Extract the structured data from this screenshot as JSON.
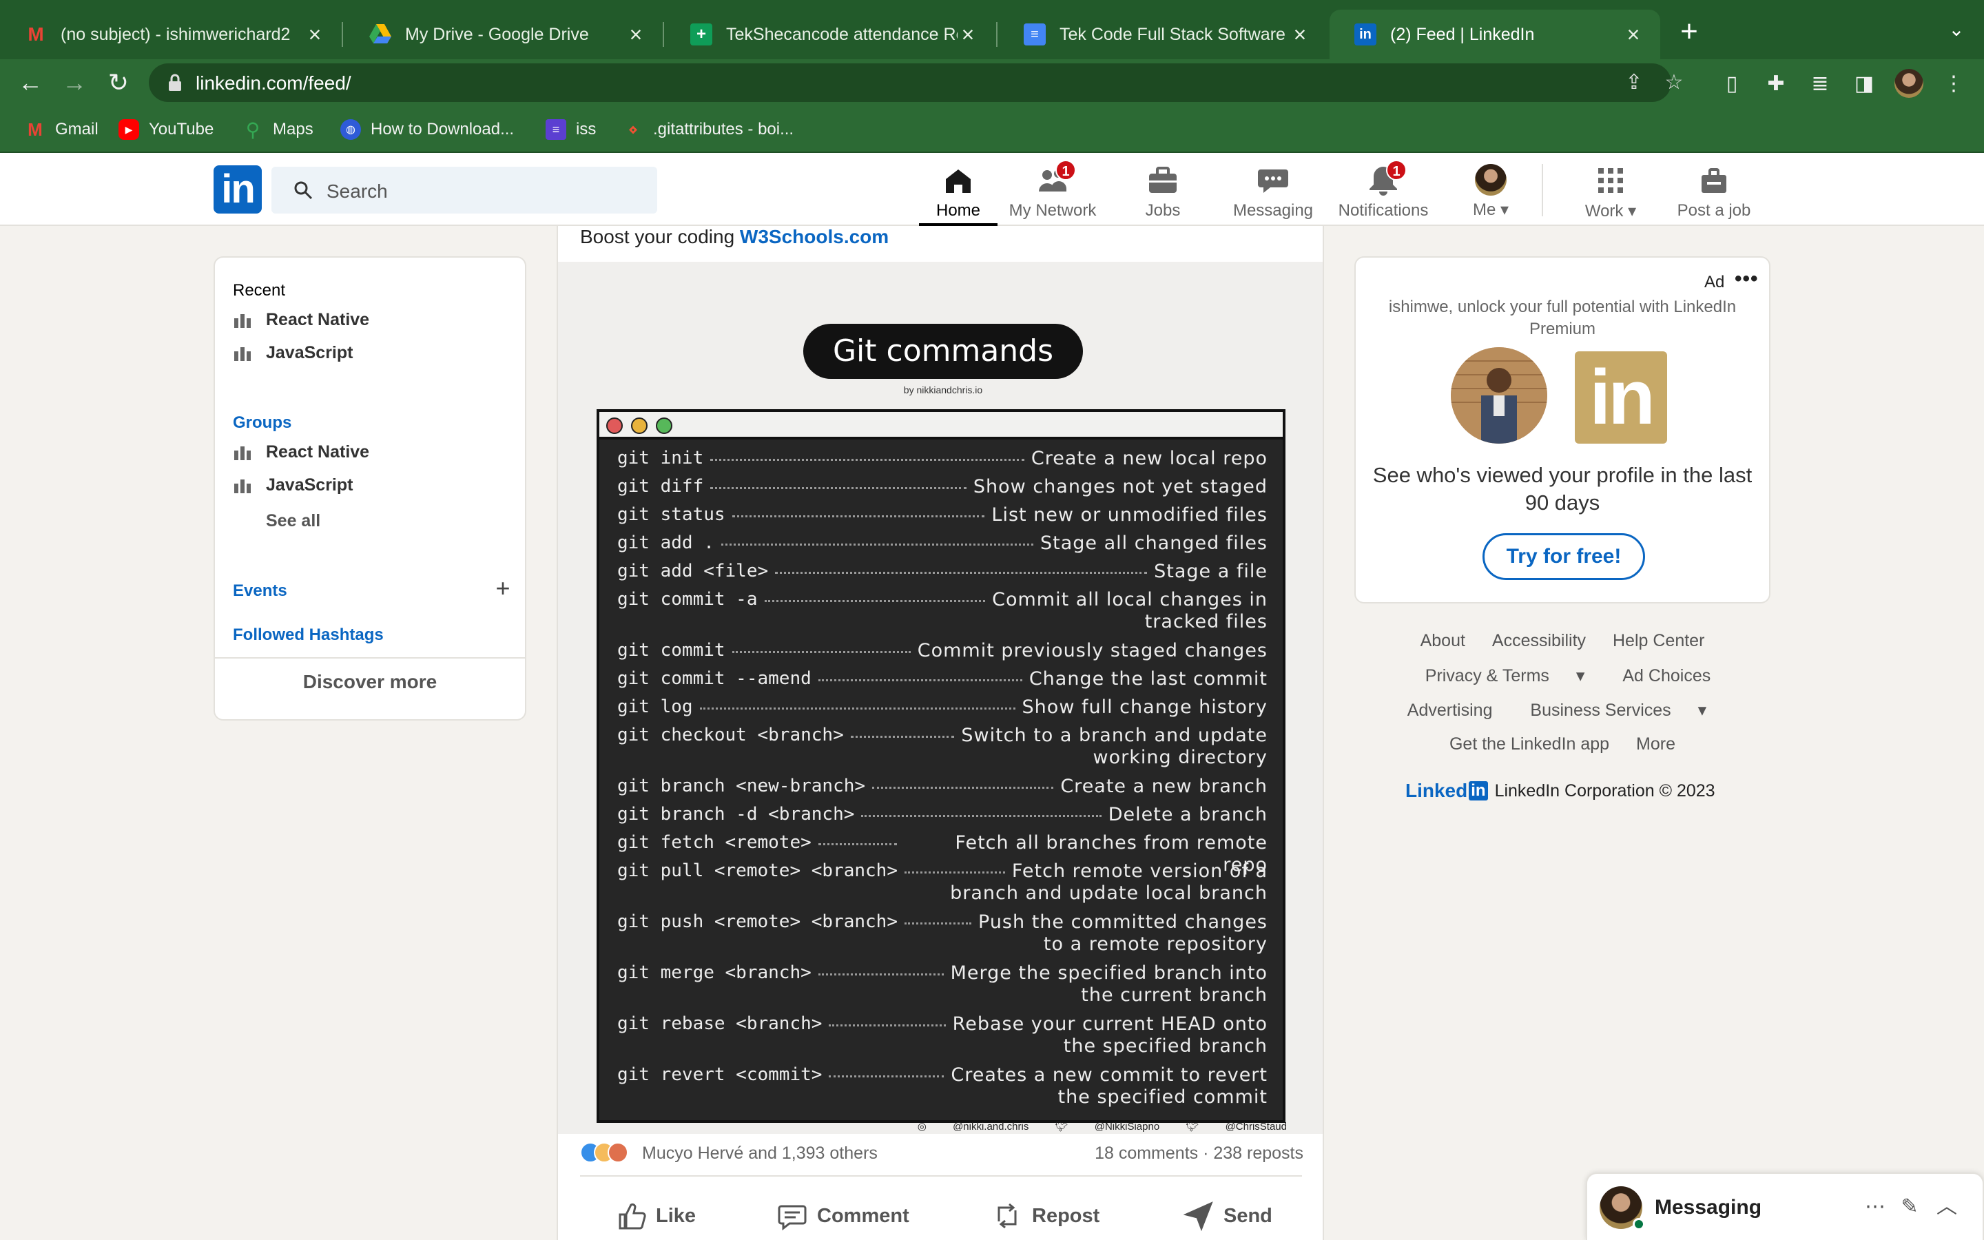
{
  "browser": {
    "tabs": [
      {
        "title": "(no subject) - ishimwerichard2",
        "icon": "gmail-icon",
        "active": false
      },
      {
        "title": "My Drive - Google Drive",
        "icon": "drive-icon",
        "active": false
      },
      {
        "title": "TekShecancode attendance Ro",
        "icon": "sheets-icon",
        "active": false
      },
      {
        "title": "Tek Code Full Stack Software D",
        "icon": "docs-icon",
        "active": false
      },
      {
        "title": "(2) Feed | LinkedIn",
        "icon": "linkedin-icon",
        "active": true
      }
    ],
    "url": "linkedin.com/feed/",
    "bookmarks": [
      {
        "label": "Gmail",
        "icon": "gmail-icon"
      },
      {
        "label": "YouTube",
        "icon": "youtube-icon"
      },
      {
        "label": "Maps",
        "icon": "maps-icon"
      },
      {
        "label": "How to Download...",
        "icon": "globe-icon"
      },
      {
        "label": "iss",
        "icon": "list-icon"
      },
      {
        "label": ".gitattributes - boi...",
        "icon": "git-icon"
      }
    ]
  },
  "header": {
    "search_placeholder": "Search",
    "nav": [
      {
        "label": "Home",
        "icon": "home-icon",
        "badge": ""
      },
      {
        "label": "My Network",
        "icon": "network-icon",
        "badge": "1"
      },
      {
        "label": "Jobs",
        "icon": "briefcase-icon",
        "badge": ""
      },
      {
        "label": "Messaging",
        "icon": "messaging-icon",
        "badge": ""
      },
      {
        "label": "Notifications",
        "icon": "bell-icon",
        "badge": "1"
      },
      {
        "label": "Me",
        "icon": "avatar-icon",
        "badge": ""
      },
      {
        "label": "Work",
        "icon": "grid-icon",
        "badge": ""
      },
      {
        "label": "Post a job",
        "icon": "post-job-icon",
        "badge": ""
      }
    ]
  },
  "left_rail": {
    "recent_heading": "Recent",
    "recent": [
      "React Native",
      "JavaScript"
    ],
    "groups_heading": "Groups",
    "groups": [
      "React Native",
      "JavaScript"
    ],
    "see_all": "See all",
    "events": "Events",
    "hashtags": "Followed Hashtags",
    "discover": "Discover more"
  },
  "post": {
    "text_prefix": "Boost your coding",
    "text_link": "W3Schools.com",
    "image": {
      "title": "Git commands",
      "byline": "by nikkiandchris.io",
      "commands": [
        {
          "cmd": "git init",
          "desc": "Create a new local repo"
        },
        {
          "cmd": "git diff",
          "desc": "Show changes not yet staged"
        },
        {
          "cmd": "git status",
          "desc": "List new or unmodified files"
        },
        {
          "cmd": "git add .",
          "desc": "Stage all changed files"
        },
        {
          "cmd": "git add <file>",
          "desc": "Stage a file"
        },
        {
          "cmd": "git commit -a",
          "desc": "Commit all local changes in\ntracked files"
        },
        {
          "cmd": "git commit",
          "desc": "Commit previously staged changes"
        },
        {
          "cmd": "git commit --amend",
          "desc": "Change the last commit"
        },
        {
          "cmd": "git log",
          "desc": "Show full change history"
        },
        {
          "cmd": "git checkout <branch>",
          "desc": "Switch to a branch and update\nworking directory"
        },
        {
          "cmd": "git branch <new-branch>",
          "desc": "Create a new branch"
        },
        {
          "cmd": "git branch -d <branch>",
          "desc": "Delete a branch"
        },
        {
          "cmd": "git fetch <remote>",
          "desc": "Fetch all branches from remote repo"
        },
        {
          "cmd": "git pull <remote> <branch>",
          "desc": "Fetch remote version of a\nbranch and update  local branch"
        },
        {
          "cmd": "git push <remote> <branch>",
          "desc": "Push the committed changes\nto a remote repository"
        },
        {
          "cmd": "git merge <branch>",
          "desc": "Merge the specified branch into\nthe current branch"
        },
        {
          "cmd": "git rebase <branch>",
          "desc": "Rebase your current HEAD onto\nthe specified branch"
        },
        {
          "cmd": "git revert <commit>",
          "desc": "Creates a new commit to revert\nthe specified commit"
        }
      ],
      "socials": [
        "@nikki.and.chris",
        "@NikkiSiapno",
        "@ChrisStaud"
      ]
    },
    "likers": "Mucyo Hervé and 1,393 others",
    "counts": "18 comments · 238 reposts",
    "actions": [
      {
        "label": "Like",
        "icon": "like-icon"
      },
      {
        "label": "Comment",
        "icon": "comment-icon"
      },
      {
        "label": "Repost",
        "icon": "repost-icon"
      },
      {
        "label": "Send",
        "icon": "send-icon"
      }
    ]
  },
  "ad": {
    "label": "Ad",
    "pitch": "ishimwe, unlock your full potential with LinkedIn Premium",
    "headline": "See who's viewed your profile in the last 90 days",
    "cta": "Try for free!"
  },
  "footer": {
    "row1": [
      "About",
      "Accessibility",
      "Help Center"
    ],
    "row2": [
      "Privacy & Terms",
      "Ad Choices"
    ],
    "row3": [
      "Advertising",
      "Business Services"
    ],
    "row4": [
      "Get the LinkedIn app",
      "More"
    ],
    "brand_word": "Linked",
    "brand_in": "in",
    "copyright": "LinkedIn Corporation © 2023"
  },
  "messaging": {
    "title": "Messaging"
  },
  "colors": {
    "linkedin_blue": "#0a66c2",
    "browser_green": "#2c6a34",
    "badge_red": "#cc1016"
  }
}
